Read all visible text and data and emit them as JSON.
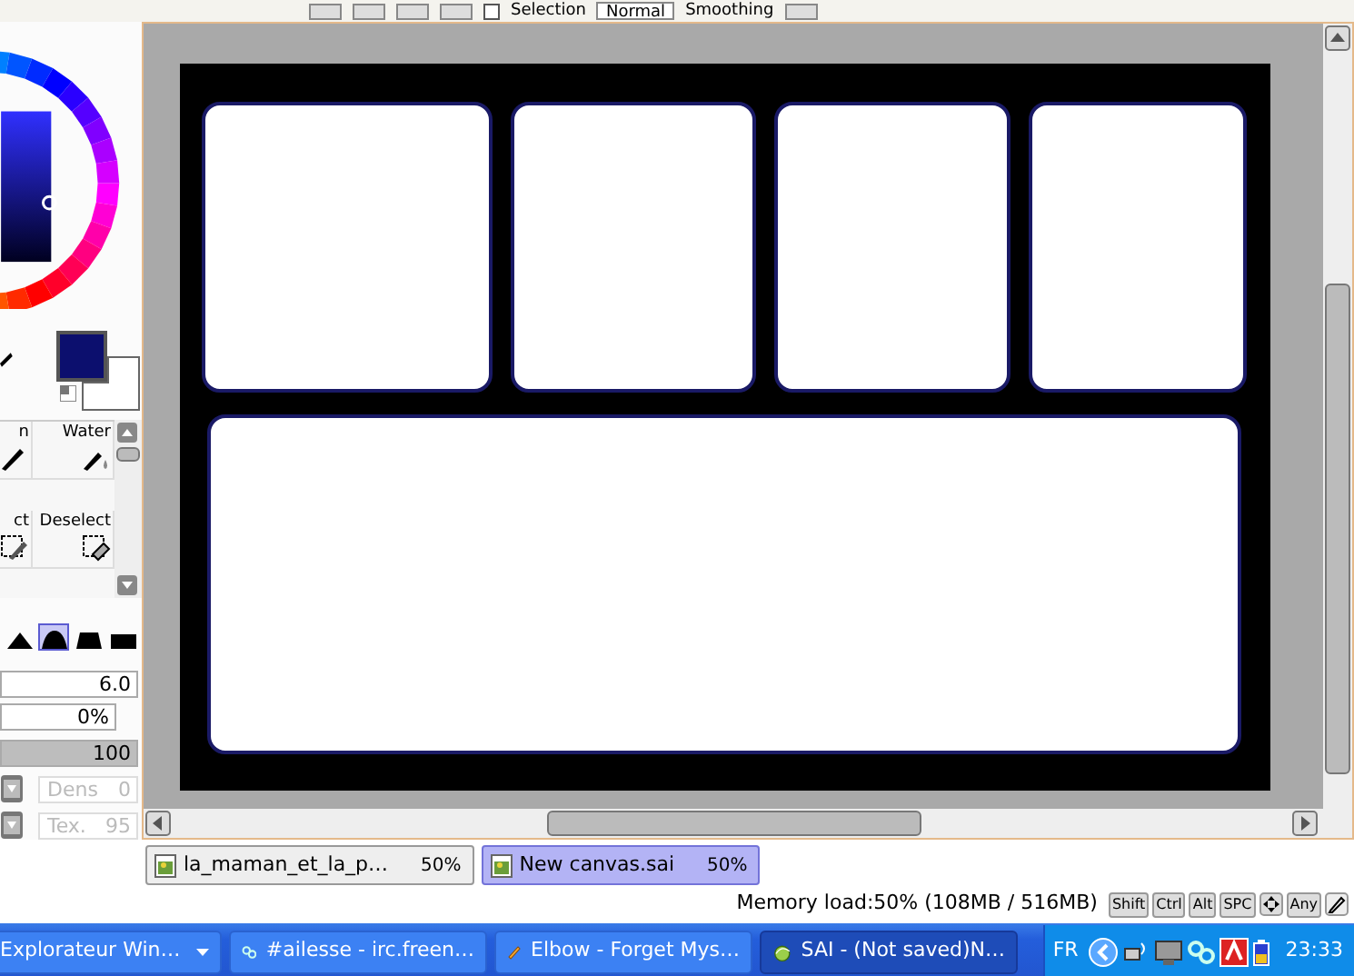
{
  "toolbar": {
    "selection_checked": false,
    "selection_label": "Selection",
    "blend_mode": "Normal",
    "smoothing_label": "Smoothing"
  },
  "tool_palette": [
    {
      "label": "n",
      "kind": "pen"
    },
    {
      "label": "Water",
      "kind": "water"
    },
    {
      "label": "ct",
      "kind": "select"
    },
    {
      "label": "Deselect",
      "kind": "deselect"
    }
  ],
  "brush_shapes": [
    {
      "selected": false
    },
    {
      "selected": true
    },
    {
      "selected": false
    },
    {
      "selected": false
    }
  ],
  "brush_settings": {
    "size": "6.0",
    "min_size": "0%",
    "density": {
      "value": "100",
      "level": 1.0
    },
    "dens": {
      "label": "Dens",
      "value": "0",
      "disabled": true
    },
    "texture": {
      "label": "Tex.",
      "value": "95",
      "disabled": true
    }
  },
  "file_tabs": [
    {
      "label": "la_maman_et_la_p…",
      "zoom": "50%",
      "selected": false
    },
    {
      "label": "New canvas.sai",
      "zoom": "50%",
      "selected": true
    }
  ],
  "status_bar": {
    "memory": "Memory load:50% (108MB / 516MB)",
    "keys": [
      "Shift",
      "Ctrl",
      "Alt",
      "SPC"
    ],
    "any": "Any"
  },
  "taskbar": {
    "tasks": [
      {
        "label": "Explorateur Win…",
        "kind": "folder",
        "selected": false
      },
      {
        "label": "#ailesse - irc.freen…",
        "kind": "chat",
        "selected": false
      },
      {
        "label": "Elbow - Forget Mys…",
        "kind": "player",
        "selected": false
      },
      {
        "label": "SAI - (Not saved)N…",
        "kind": "sai",
        "selected": true
      }
    ],
    "language": "FR",
    "clock": "23:33"
  }
}
